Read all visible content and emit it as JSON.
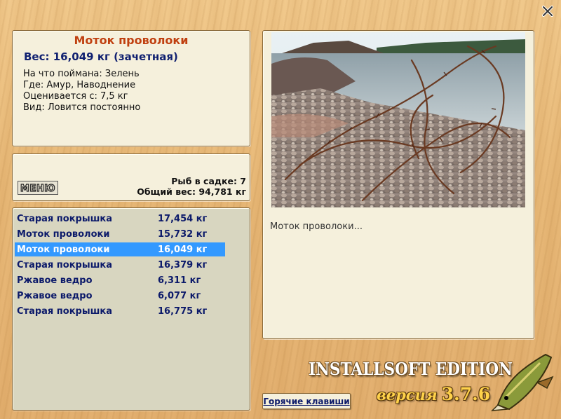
{
  "window": {
    "close_label": "X"
  },
  "catch_info": {
    "title": "Моток проволоки",
    "weight": "Вес: 16,049 кг (зачетная)",
    "caught_on": "На что поймана: Зелень",
    "location": "Где: Амур, Наводнение",
    "rated_from": "Оценивается с: 7,5 кг",
    "kind": "Вид: Ловится постоянно"
  },
  "cage": {
    "menu_label": "МЕНЮ",
    "fish_count": "Рыб в садке: 7",
    "total_weight": "Общий вес: 94,781 кг"
  },
  "catch_list": [
    {
      "name": "Старая покрышка",
      "weight": "17,454 кг",
      "selected": false
    },
    {
      "name": "Моток проволоки",
      "weight": "15,732 кг",
      "selected": false
    },
    {
      "name": "Моток проволоки",
      "weight": "16,049 кг",
      "selected": true
    },
    {
      "name": "Старая покрышка",
      "weight": "16,379 кг",
      "selected": false
    },
    {
      "name": "Ржавое ведро",
      "weight": "6,311 кг",
      "selected": false
    },
    {
      "name": "Ржавое ведро",
      "weight": "6,077 кг",
      "selected": false
    },
    {
      "name": "Старая покрышка",
      "weight": "16,775 кг",
      "selected": false
    }
  ],
  "photo": {
    "caption": "Моток проволоки..."
  },
  "footer": {
    "hotkeys_label": "Горячие клавиши",
    "edition": "INSTALLSOFT EDITION",
    "version_label": "версия",
    "version_number": "3.7.6"
  },
  "colors": {
    "selected_row": "#3399ff",
    "title": "#c04010",
    "list_text": "#0c1a6a",
    "panel_bg": "#f5f0dc"
  }
}
